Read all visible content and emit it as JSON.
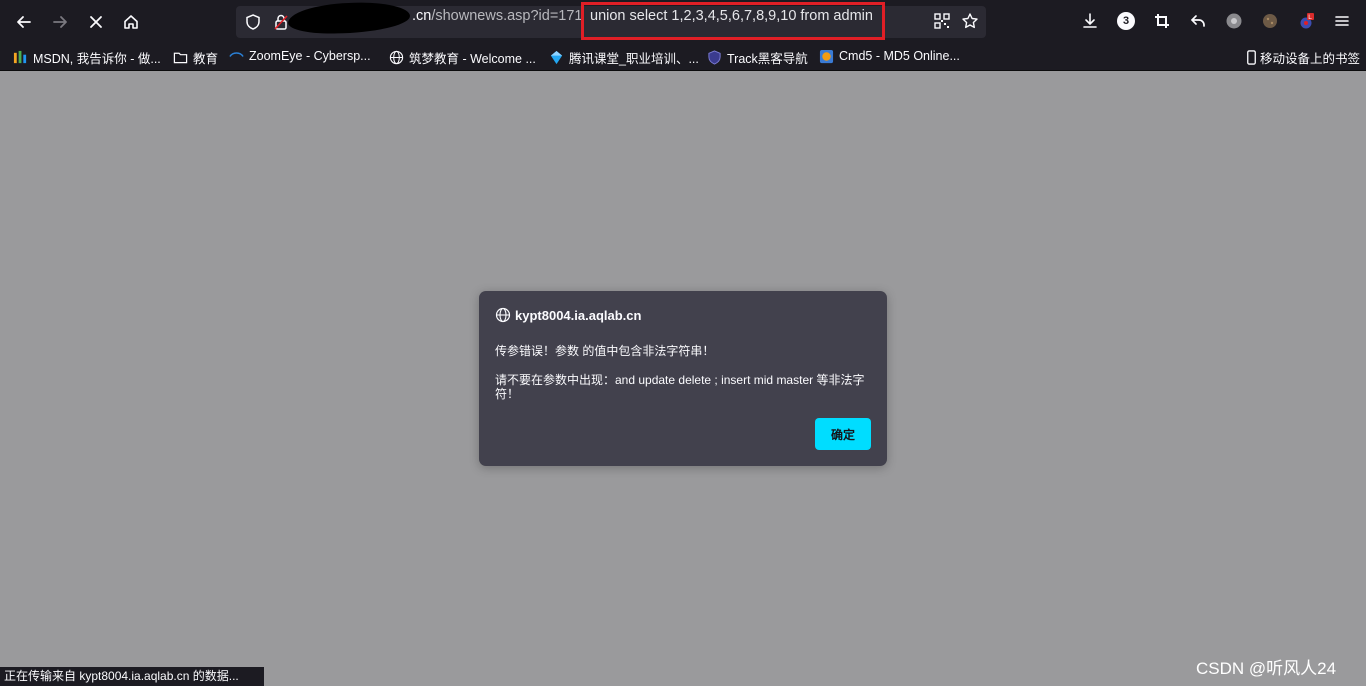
{
  "browser": {
    "url_host_suffix": ".cn",
    "url_path": "/shownews.asp?id=171",
    "url_injection": "union select 1,2,3,4,5,6,7,8,9,10 from admin",
    "downloads_badge": "3"
  },
  "bookmarks": [
    {
      "label": "MSDN, 我告诉你 - 做...",
      "icon": "msdn-icon"
    },
    {
      "label": "教育",
      "icon": "folder-icon"
    },
    {
      "label": "ZoomEye - Cybersp...",
      "icon": "zoomeye-icon"
    },
    {
      "label": "筑梦教育 - Welcome ...",
      "icon": "globe-icon"
    },
    {
      "label": "腾讯课堂_职业培训、...",
      "icon": "tencent-icon"
    },
    {
      "label": "Track黑客导航",
      "icon": "shield-icon"
    },
    {
      "label": "Cmd5 - MD5 Online...",
      "icon": "cmd5-icon"
    }
  ],
  "mobile_bookmarks": "移动设备上的书签",
  "dialog": {
    "origin": "kypt8004.ia.aqlab.cn",
    "message1": "传参错误！参数 的值中包含非法字符串！",
    "message2": "请不要在参数中出现：and update delete ; insert mid master 等非法字符！",
    "confirm": "确定"
  },
  "status_text": "正在传输来自 kypt8004.ia.aqlab.cn 的数据...",
  "watermark": "CSDN @听风人24",
  "colors": {
    "toolbar": "#1c1b22",
    "urlbar": "#2b2a33",
    "highlight": "#e01f26",
    "dialog": "#42414d",
    "button": "#00ddff",
    "overlay": "#9a9a9c"
  }
}
